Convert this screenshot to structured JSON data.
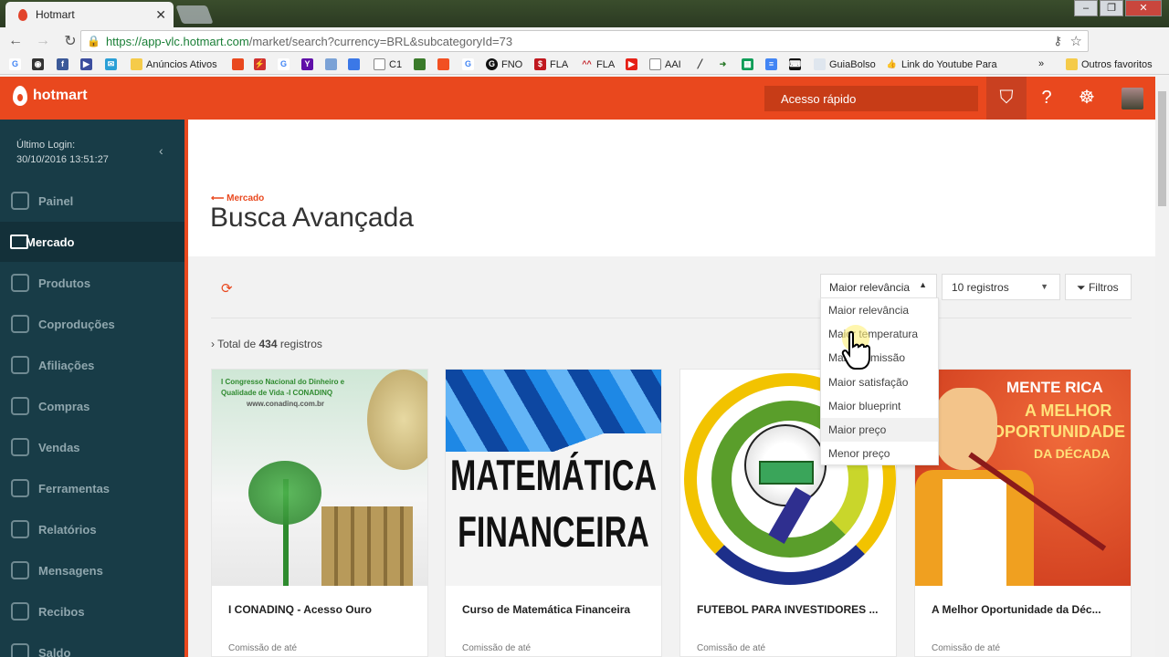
{
  "browser": {
    "tab_title": "Hotmart",
    "url_host": "https://app-vlc.hotmart.com",
    "url_path": "/market/search?currency=BRL&subcategoryId=73",
    "bookmarks": [
      "Anúncios Ativos",
      "C1",
      "FNO",
      "FLA",
      "FLA",
      "AAI",
      "GuiaBolso",
      "Link do Youtube Para",
      "Outros favoritos"
    ]
  },
  "header": {
    "logo": "hotmart",
    "quick_access": "Acesso rápido"
  },
  "sidebar": {
    "last_login_label": "Último Login:",
    "last_login_value": "30/10/2016 13:51:27",
    "items": [
      {
        "label": "Painel"
      },
      {
        "label": "Mercado"
      },
      {
        "label": "Produtos"
      },
      {
        "label": "Coproduções"
      },
      {
        "label": "Afiliações"
      },
      {
        "label": "Compras"
      },
      {
        "label": "Vendas"
      },
      {
        "label": "Ferramentas"
      },
      {
        "label": "Relatórios"
      },
      {
        "label": "Mensagens"
      },
      {
        "label": "Recibos"
      },
      {
        "label": "Saldo"
      }
    ]
  },
  "main": {
    "breadcrumb": "Mercado",
    "title": "Busca Avançada",
    "sort_selected": "Maior relevância",
    "records_selected": "10 registros",
    "filters_label": "Filtros",
    "total_prefix": "Total de",
    "total_count": "434",
    "total_suffix": "registros",
    "sort_options": [
      "Maior relevância",
      "Maior temperatura",
      "Maior comissão",
      "Maior satisfação",
      "Maior blueprint",
      "Maior preço",
      "Menor preço"
    ]
  },
  "cards": [
    {
      "name": "I CONADINQ - Acesso Ouro",
      "commission_label": "Comissão de até",
      "img_text": [
        "I Congresso Nacional do Dinheiro e",
        "Qualidade de Vida -I CONADINQ",
        "www.conadinq.com.br"
      ]
    },
    {
      "name": "Curso de Matemática Financeira",
      "commission_label": "Comissão de até",
      "img_text": [
        "MATEMÁTICA",
        "FINANCEIRA"
      ]
    },
    {
      "name": "FUTEBOL PARA INVESTIDORES ...",
      "commission_label": "Comissão de até"
    },
    {
      "name": "A Melhor Oportunidade da Déc...",
      "commission_label": "Comissão de até",
      "img_text": [
        "MENTE RICA",
        "A MELHOR",
        "OPORTUNIDADE",
        "DA DÉCADA"
      ]
    }
  ]
}
